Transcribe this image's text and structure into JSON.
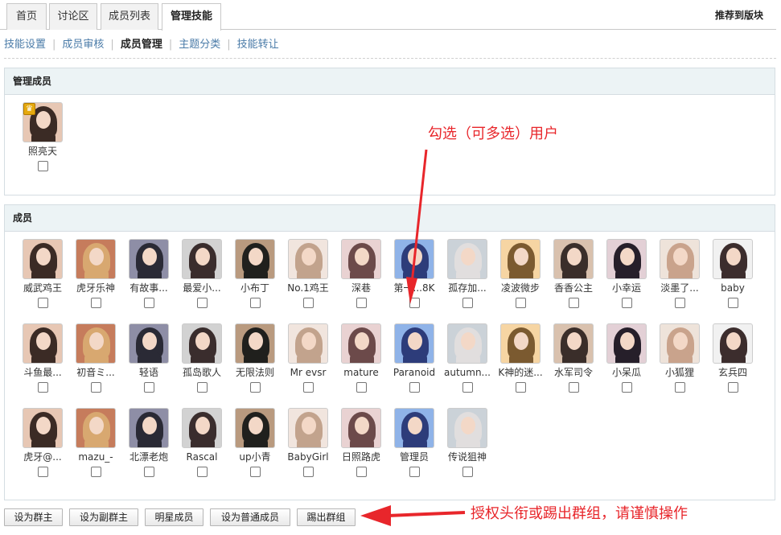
{
  "tabs": [
    {
      "label": "首页"
    },
    {
      "label": "讨论区"
    },
    {
      "label": "成员列表"
    },
    {
      "label": "管理技能"
    }
  ],
  "recommend_label": "推荐到版块",
  "subnav": [
    {
      "label": "技能设置"
    },
    {
      "label": "成员审核"
    },
    {
      "label": "成员管理"
    },
    {
      "label": "主题分类"
    },
    {
      "label": "技能转让"
    }
  ],
  "managers_section": {
    "title": "管理成员",
    "items": [
      {
        "name": "照亮天"
      }
    ]
  },
  "members_section": {
    "title": "成员",
    "items": [
      {
        "name": "威武鸡王"
      },
      {
        "name": "虎牙乐神"
      },
      {
        "name": "有故事..."
      },
      {
        "name": "最爱小..."
      },
      {
        "name": "小布丁"
      },
      {
        "name": "No.1鸡王"
      },
      {
        "name": "深巷"
      },
      {
        "name": "第一...8K"
      },
      {
        "name": "孤存加..."
      },
      {
        "name": "凌波微步"
      },
      {
        "name": "香香公主"
      },
      {
        "name": "小幸运"
      },
      {
        "name": "淡墨了..."
      },
      {
        "name": "baby"
      },
      {
        "name": "斗鱼最..."
      },
      {
        "name": "初音ミ..."
      },
      {
        "name": "轻语"
      },
      {
        "name": "孤岛歌人"
      },
      {
        "name": "无限法则"
      },
      {
        "name": "Mr evsr"
      },
      {
        "name": "mature"
      },
      {
        "name": "Paranoid"
      },
      {
        "name": "autumn..."
      },
      {
        "name": "K神的迷..."
      },
      {
        "name": "水军司令"
      },
      {
        "name": "小呆瓜"
      },
      {
        "name": "小狐狸"
      },
      {
        "name": "玄兵四"
      },
      {
        "name": "虎牙@..."
      },
      {
        "name": "mazu_-"
      },
      {
        "name": "北漂老炮"
      },
      {
        "name": "Rascal"
      },
      {
        "name": "up小青"
      },
      {
        "name": "BabyGirl"
      },
      {
        "name": "日照路虎"
      },
      {
        "name": "管理员"
      },
      {
        "name": "传说狙神"
      }
    ]
  },
  "buttons": [
    {
      "label": "设为群主"
    },
    {
      "label": "设为副群主"
    },
    {
      "label": "明星成员"
    },
    {
      "label": "设为普通成员"
    },
    {
      "label": "踢出群组"
    }
  ],
  "annotations": {
    "select_users": "勾选（可多选）用户",
    "warning": "授权头衔或踢出群组，请谨慎操作"
  },
  "colors": {
    "annotation_red": "#e8262b",
    "link_blue": "#4a7ba8",
    "section_header_bg": "#ecf3f5"
  }
}
